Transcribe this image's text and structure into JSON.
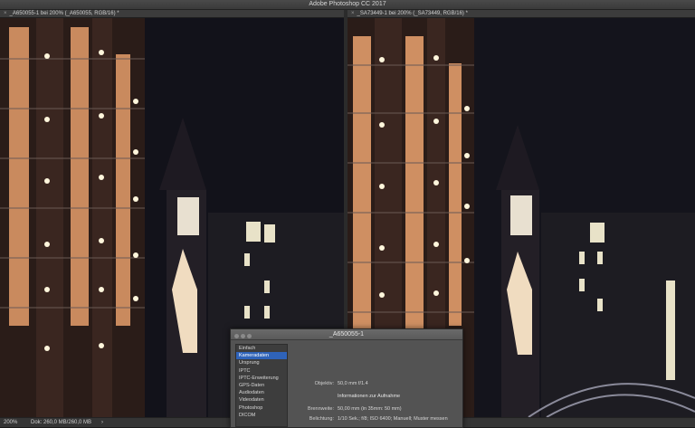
{
  "app": {
    "title": "Adobe Photoshop CC 2017"
  },
  "left_doc": {
    "tab_label": "_A650055-1 bei 200% (_A650055, RGB/16) *"
  },
  "right_doc": {
    "tab_label": "_SA73449-1 bei 200% (_SA73449, RGB/16) *"
  },
  "status": {
    "zoom": "200%",
    "doc": "Dok: 260,0 MB/260,0 MB",
    "arrow": "›"
  },
  "dialog": {
    "title": "_A650055-1",
    "categories": [
      {
        "label": "Einfach"
      },
      {
        "label": "Kameradaten",
        "selected": true
      },
      {
        "label": "Ursprung"
      },
      {
        "label": "IPTC"
      },
      {
        "label": "IPTC-Erweiterung"
      },
      {
        "label": "GPS-Daten"
      },
      {
        "label": "Audiodaten"
      },
      {
        "label": "Videodaten"
      },
      {
        "label": "Photoshop"
      },
      {
        "label": "DICOM"
      }
    ],
    "objective_label": "Objektiv:",
    "objective_value": "50,0 mm f/1.4",
    "section_title": "Informationen zur Aufnahme",
    "focal_label": "Brennweite:",
    "focal_value": "50,00 mm  (in 35mm: 50 mm)",
    "exposure_label": "Belichtung:",
    "exposure_value": "1/10 Sek.; f/8; ISO 6400;  Manuell;  Muster messen"
  },
  "colors": {
    "selection": "#2f63b9",
    "night_sky": "#12121a",
    "warm_light": "#e8a06a"
  }
}
